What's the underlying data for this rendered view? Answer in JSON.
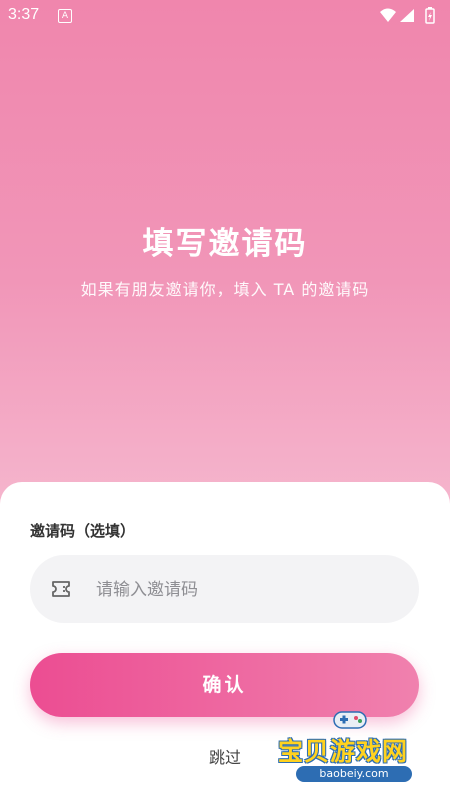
{
  "status_bar": {
    "time": "3:37",
    "a_badge": "A"
  },
  "hero": {
    "title": "填写邀请码",
    "subtitle": "如果有朋友邀请你，填入 TA 的邀请码"
  },
  "form": {
    "label": "邀请码（选填）",
    "placeholder": "请输入邀请码",
    "value": "",
    "ticket_icon": "ticket-icon",
    "confirm_label": "确认",
    "skip_label": "跳过"
  },
  "watermark": {
    "name": "宝贝游戏网",
    "url": "baobeiy.com"
  },
  "colors": {
    "bg_top": "#f086ad",
    "bg_bottom": "#f7c3d4",
    "button_start": "#ec4d92",
    "button_end": "#f081ae",
    "input_bg": "#f3f3f5"
  }
}
